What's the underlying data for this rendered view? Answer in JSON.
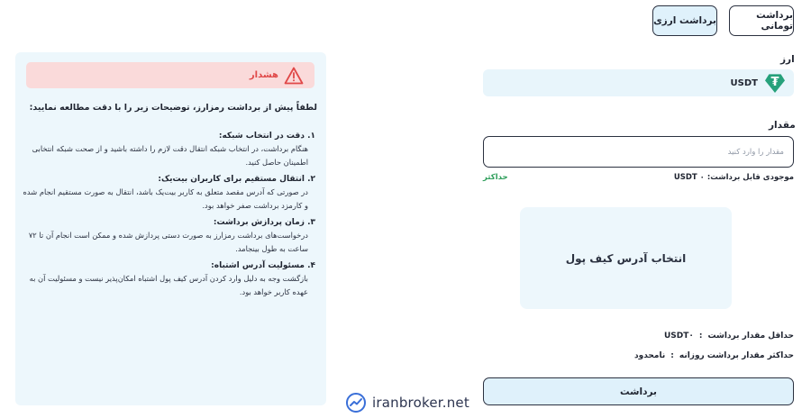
{
  "tabs": {
    "toman": "برداشت تومانی",
    "crypto": "برداشت ارزی"
  },
  "currency": {
    "label": "ارز",
    "code": "USDT",
    "icon": "tether-icon",
    "icon_glyph": "₮"
  },
  "amount": {
    "label": "مقدار",
    "placeholder": "مقدار را وارد کنید",
    "value": ""
  },
  "balance": {
    "text": "موجودی قابل برداشت: ۰ USDT",
    "max_label": "حداکثر"
  },
  "wallet": {
    "label": "انتخاب آدرس کیف پول"
  },
  "limits": {
    "min_label": "حداقل مقدار برداشت",
    "min_value": "USDT۰",
    "daily_max_label": "حداکثر مقدار برداشت روزانه",
    "daily_max_value": "نامحدود",
    "separator": ":"
  },
  "submit_label": "برداشت",
  "warning": {
    "title": "هشدار",
    "intro": "لطفاً پیش از برداشت رمزارز، توضیحات زیر را با دقت مطالعه نمایید:",
    "items": [
      {
        "title": "۱. دقت در انتخاب شبکه:",
        "text": "هنگام برداشت، در انتخاب شبکه انتقال دقت لازم را داشته باشید و از صحت شبکه انتخابی اطمینان حاصل کنید."
      },
      {
        "title": "۲. انتقال مستقیم برای کاربران بیت‌یک:",
        "text": "در صورتی که آدرس مقصد متعلق به کاربر بیت‌یک باشد، انتقال به صورت مستقیم انجام شده و کارمزد برداشت صفر خواهد بود."
      },
      {
        "title": "۳. زمان پردازش برداشت:",
        "text": "درخواست‌های برداشت رمزارز به صورت دستی پردازش شده و ممکن است انجام آن تا ۷۲ ساعت به طول بینجامد."
      },
      {
        "title": "۴. مسئولیت آدرس اشتباه:",
        "text": "بازگشت وجه به دلیل وارد کردن آدرس کیف پول اشتباه امکان‌پذیر نیست و مسئولیت آن به عهده کاربر خواهد بود."
      }
    ]
  },
  "watermark": {
    "text": "iranbroker.net"
  },
  "colors": {
    "accent_light": "#dff1fb",
    "panel_bg": "#edf7fc",
    "warning_bg": "#fadada",
    "warning_text": "#e04848",
    "max_link": "#2e9e5b",
    "tether": "#26a17b"
  }
}
